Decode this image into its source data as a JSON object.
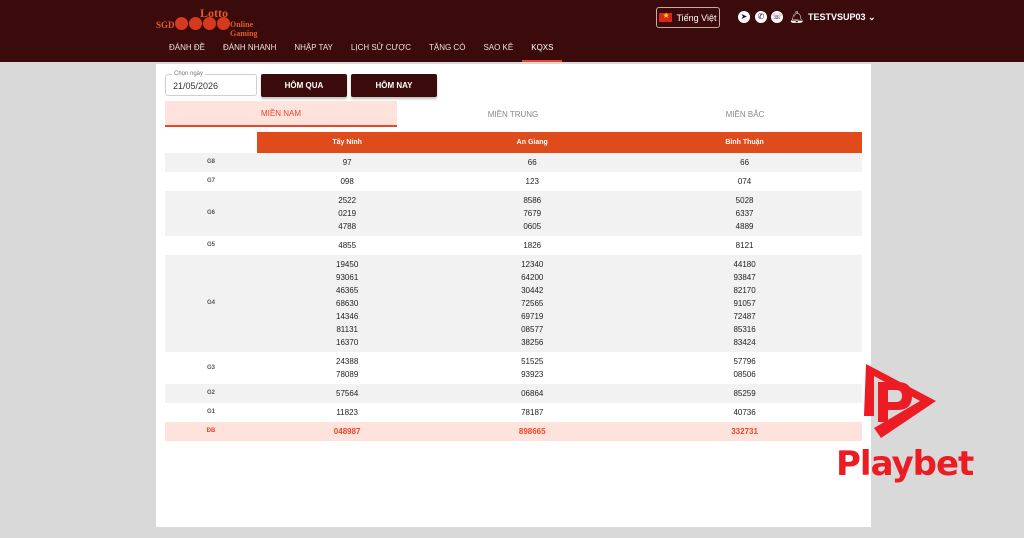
{
  "header": {
    "logo": {
      "top": "Lotto",
      "left": "SGD",
      "right": "Online Gaming"
    },
    "language": "Tiếng Việt",
    "username": "TESTVSUP03",
    "nav": [
      {
        "label": "ĐÁNH ĐỀ",
        "active": false
      },
      {
        "label": "ĐÁNH NHANH",
        "active": false
      },
      {
        "label": "NHẬP TAY",
        "active": false
      },
      {
        "label": "LỊCH SỬ CƯỢC",
        "active": false
      },
      {
        "label": "TẶNG CÓ",
        "active": false
      },
      {
        "label": "SAO KÊ",
        "active": false
      },
      {
        "label": "KQXS",
        "active": true
      }
    ]
  },
  "filters": {
    "date_label": "Chọn ngày",
    "date_value": "21/05/2026",
    "yesterday": "HÔM QUA",
    "today": "HÔM NAY"
  },
  "regions": [
    {
      "label": "MIỀN NAM",
      "active": true
    },
    {
      "label": "MIỀN TRUNG",
      "active": false
    },
    {
      "label": "MIỀN BẮC",
      "active": false
    }
  ],
  "provinces": [
    "Tây Ninh",
    "An Giang",
    "Bình Thuận"
  ],
  "results": [
    {
      "prize": "G8",
      "values": [
        [
          "97"
        ],
        [
          "66"
        ],
        [
          "66"
        ]
      ]
    },
    {
      "prize": "G7",
      "values": [
        [
          "098"
        ],
        [
          "123"
        ],
        [
          "074"
        ]
      ]
    },
    {
      "prize": "G6",
      "values": [
        [
          "2522",
          "0219",
          "4788"
        ],
        [
          "8586",
          "7679",
          "0605"
        ],
        [
          "5028",
          "6337",
          "4889"
        ]
      ]
    },
    {
      "prize": "G5",
      "values": [
        [
          "4855"
        ],
        [
          "1826"
        ],
        [
          "8121"
        ]
      ]
    },
    {
      "prize": "G4",
      "values": [
        [
          "19450",
          "93061",
          "46365",
          "68630",
          "14346",
          "81131",
          "16370"
        ],
        [
          "12340",
          "64200",
          "30442",
          "72565",
          "69719",
          "08577",
          "38256"
        ],
        [
          "44180",
          "93847",
          "82170",
          "91057",
          "72487",
          "85316",
          "83424"
        ]
      ]
    },
    {
      "prize": "G3",
      "values": [
        [
          "24388",
          "78089"
        ],
        [
          "51525",
          "93923"
        ],
        [
          "57796",
          "08506"
        ]
      ]
    },
    {
      "prize": "G2",
      "values": [
        [
          "57564"
        ],
        [
          "06864"
        ],
        [
          "85259"
        ]
      ]
    },
    {
      "prize": "G1",
      "values": [
        [
          "11823"
        ],
        [
          "78187"
        ],
        [
          "40736"
        ]
      ]
    },
    {
      "prize": "ĐB",
      "values": [
        [
          "048987"
        ],
        [
          "898665"
        ],
        [
          "332731"
        ]
      ]
    }
  ],
  "watermark": "Playbet",
  "colors": {
    "header_bg": "#3b0a0a",
    "accent": "#e04b1c",
    "special_row": "#fde3dc",
    "watermark": "#ec1c24"
  }
}
